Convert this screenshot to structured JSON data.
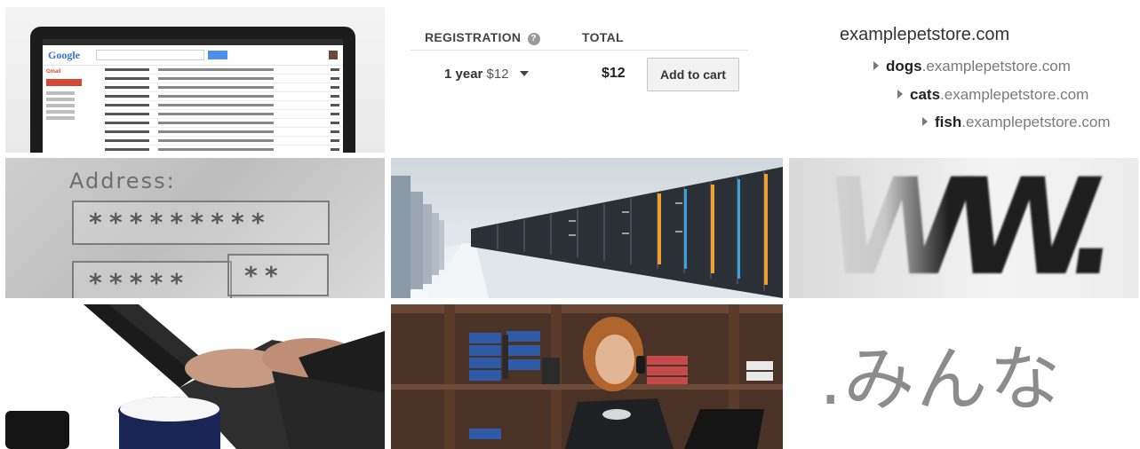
{
  "tiles": {
    "laptop": {
      "logo": "Google",
      "folder": "Gmail",
      "icon": "laptop-gmail-photo"
    },
    "registration": {
      "header_registration": "REGISTRATION",
      "header_total": "TOTAL",
      "help_icon": "?",
      "term": "1 year",
      "term_price": "$12",
      "total": "$12",
      "add_to_cart_label": "Add to cart"
    },
    "domains": {
      "root": "examplepetstore.com",
      "items": [
        {
          "prefix": "dogs",
          "suffix": ".examplepetstore.com"
        },
        {
          "prefix": "cats",
          "suffix": ".examplepetstore.com"
        },
        {
          "prefix": "fish",
          "suffix": ".examplepetstore.com"
        }
      ]
    },
    "address": {
      "label": "Address:",
      "field1": "*********",
      "field2": "*****",
      "field3": "**"
    },
    "datacenter": {
      "icon": "server-racks-photo"
    },
    "www": {
      "text": "WW."
    },
    "typing": {
      "icon": "hands-typing-photo"
    },
    "shop": {
      "icon": "woman-on-phone-in-shop-photo"
    },
    "minna": {
      "text": ".みんな"
    }
  },
  "colors": {
    "button_bg": "#f2f2f2",
    "gmail_red": "#d14836",
    "google_blue": "#3b6fd6"
  }
}
